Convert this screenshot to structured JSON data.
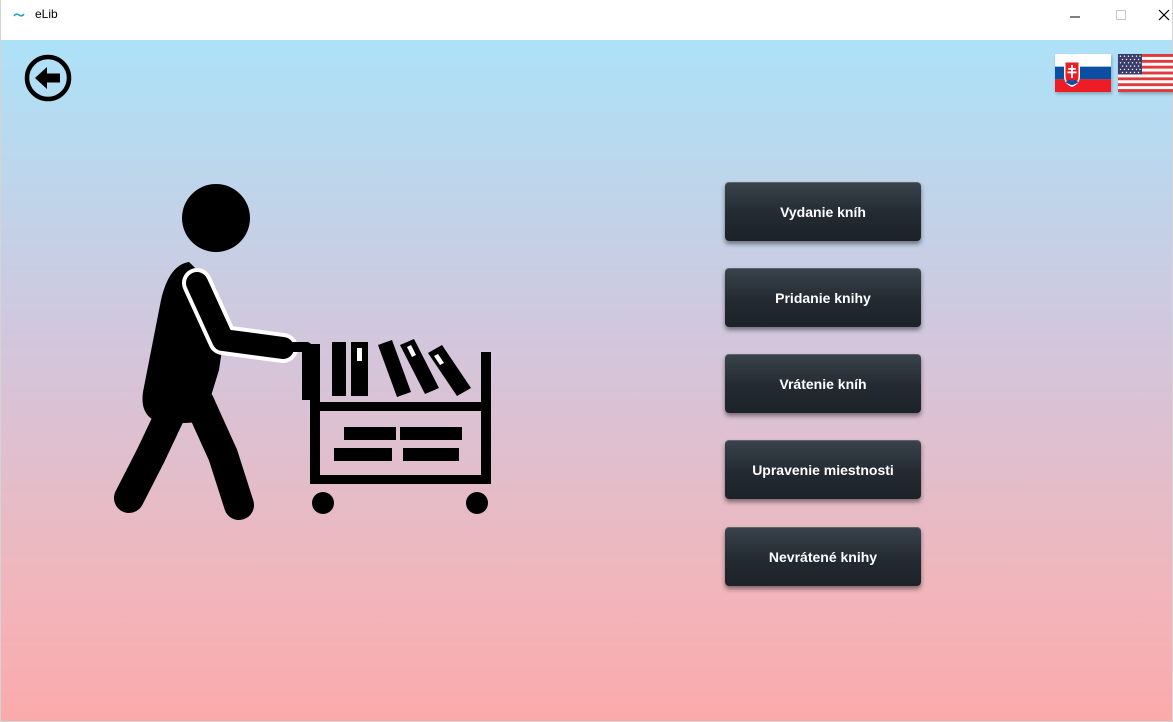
{
  "window": {
    "title": "eLib",
    "controls": {
      "minimize_icon": "minimize-icon",
      "maximize_icon": "maximize-icon",
      "close_icon": "close-icon"
    }
  },
  "header": {
    "back_icon": "arrow-left-circle-icon",
    "languages": [
      {
        "code": "sk",
        "flag": "slovakia-flag-icon"
      },
      {
        "code": "en",
        "flag": "usa-flag-icon"
      }
    ]
  },
  "illustration": {
    "icon": "person-pushing-book-cart-icon"
  },
  "menu": {
    "buttons": [
      {
        "label": "Vydanie kníh"
      },
      {
        "label": "Pridanie knihy"
      },
      {
        "label": "Vrátenie kníh"
      },
      {
        "label": "Upravenie miestnosti"
      },
      {
        "label": "Nevrátené knihy"
      }
    ]
  },
  "colors": {
    "gradient_top": "#ace2f8",
    "gradient_bottom": "#fbaaab",
    "button_dark": "#232a31",
    "button_text": "#ffffff"
  }
}
